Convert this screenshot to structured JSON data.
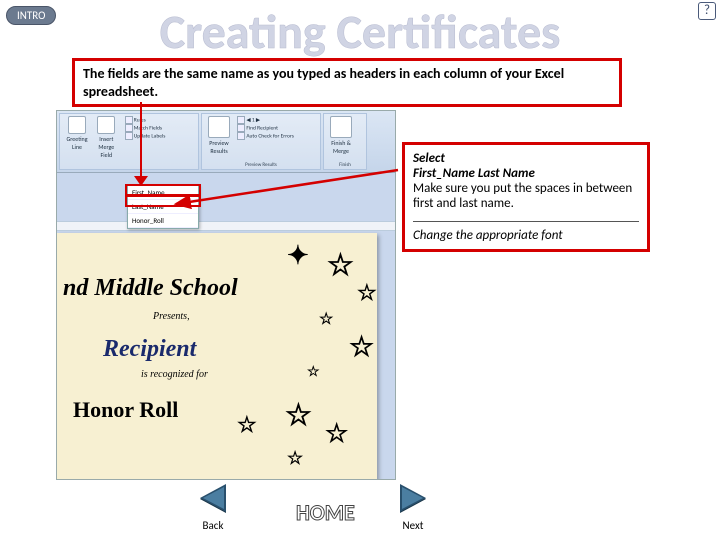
{
  "badges": {
    "intro": "INTRO",
    "help": "?"
  },
  "title": "Creating Certificates",
  "callout_top": "The fields are the same name as you typed as headers in each column of your Excel spreadsheet.",
  "callout_right": {
    "select_label": "Select",
    "fields": "First_Name Last Name",
    "body": "Make sure you put the spaces in between first and last name.",
    "font_note": "Change the appropriate font"
  },
  "ribbon": {
    "groups": [
      {
        "buttons": [
          "Greeting Line",
          "Insert Merge Field"
        ],
        "rows": [
          "Rules",
          "Match Fields",
          "Update Labels"
        ],
        "label": ""
      },
      {
        "buttons": [
          "Preview Results"
        ],
        "rows": [
          "Find Recipient",
          "Auto Check for Errors"
        ],
        "label": "Preview Results"
      },
      {
        "buttons": [
          "Finish & Merge"
        ],
        "label": "Finish"
      }
    ]
  },
  "dropdown": {
    "items": [
      "First_Name",
      "Last_Name",
      "Honor_Roll"
    ]
  },
  "certificate": {
    "school": "nd Middle School",
    "presents": "Presents,",
    "recipient": "Recipient",
    "recognized": "is recognized for",
    "honor": "Honor Roll"
  },
  "nav": {
    "back": "Back",
    "home": "HOME",
    "next": "Next"
  }
}
